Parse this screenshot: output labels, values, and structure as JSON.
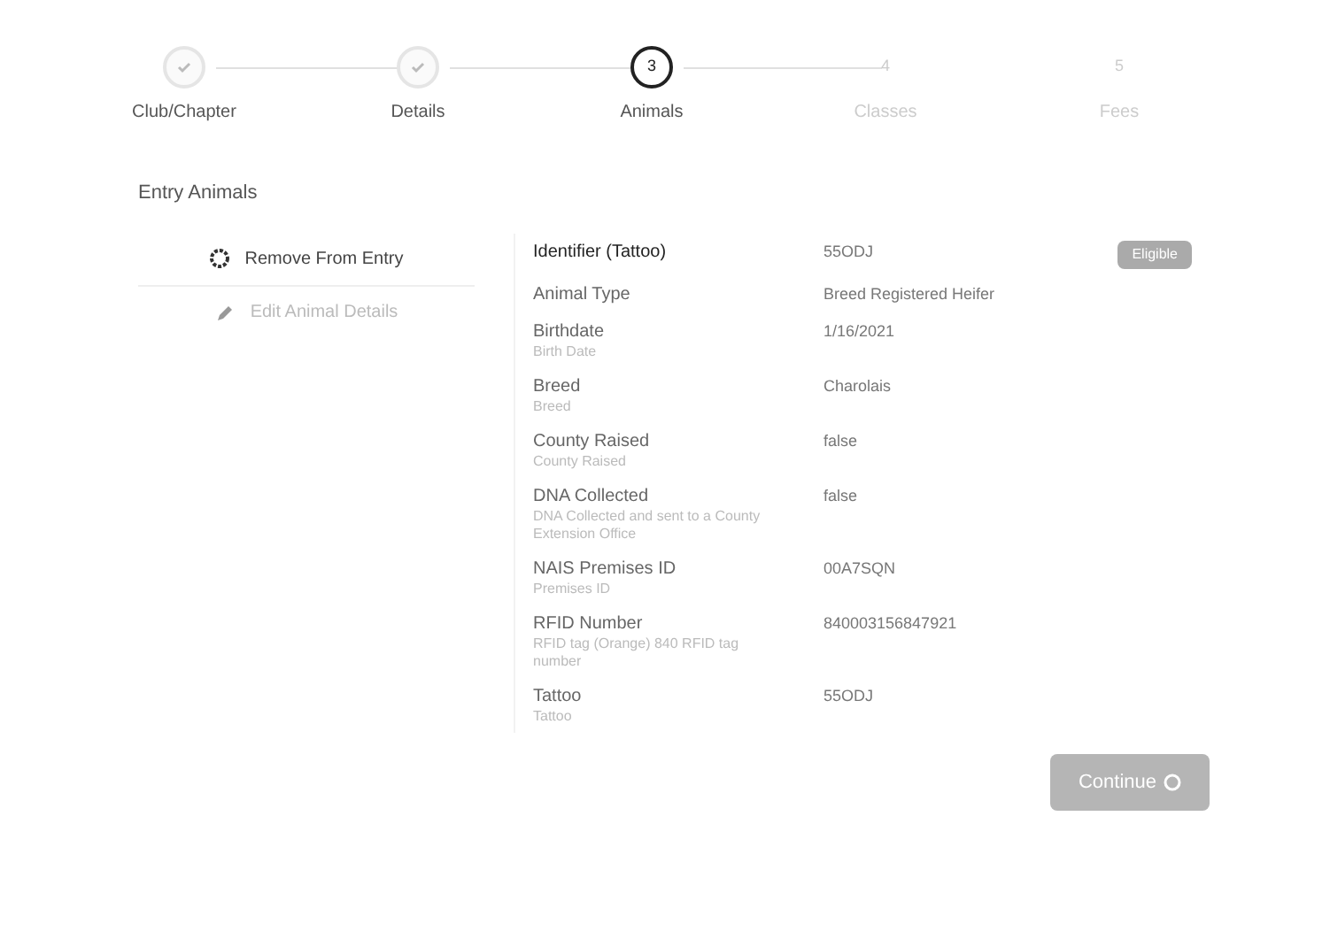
{
  "steps": [
    {
      "label": "Club/Chapter",
      "kind": "done"
    },
    {
      "label": "Details",
      "kind": "done"
    },
    {
      "label": "Animals",
      "number": "3",
      "kind": "current"
    },
    {
      "label": "Classes",
      "number": "4",
      "kind": "todo"
    },
    {
      "label": "Fees",
      "number": "5",
      "kind": "todo"
    }
  ],
  "section_title": "Entry Animals",
  "actions": [
    {
      "label": "Remove From Entry",
      "kind": "remove"
    },
    {
      "label": "Edit Animal Details",
      "kind": "edit"
    }
  ],
  "fields": [
    {
      "label": "Identifier (Tattoo)",
      "value": "55ODJ",
      "badge": "Eligible"
    },
    {
      "label": "Animal Type",
      "value": "Breed Registered Heifer"
    },
    {
      "label": "Birthdate",
      "hint": "Birth Date",
      "value": "1/16/2021"
    },
    {
      "label": "Breed",
      "hint": "Breed",
      "value": "Charolais"
    },
    {
      "label": "County Raised",
      "hint": "County Raised",
      "value": "false"
    },
    {
      "label": "DNA Collected",
      "hint": "DNA Collected and sent to a County Extension Office",
      "value": "false"
    },
    {
      "label": "NAIS Premises ID",
      "hint": "Premises ID",
      "value": "00A7SQN"
    },
    {
      "label": "RFID Number",
      "hint": "RFID tag (Orange) 840 RFID tag number",
      "value": "840003156847921"
    },
    {
      "label": "Tattoo",
      "hint": "Tattoo",
      "value": "55ODJ"
    }
  ],
  "continue_button": "Continue"
}
